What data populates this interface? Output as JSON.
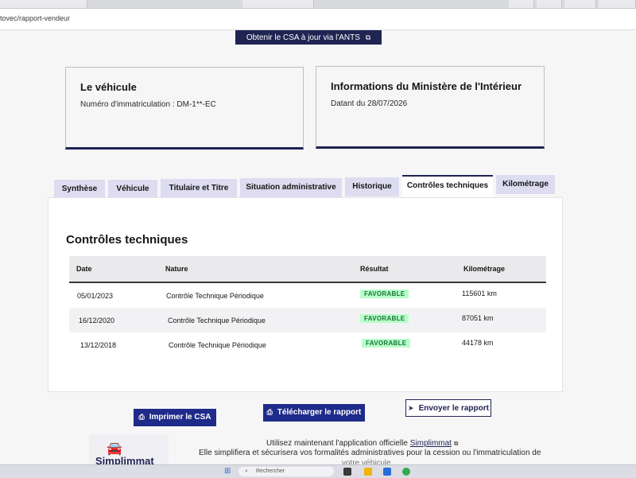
{
  "browser": {
    "tabs": [
      "",
      "",
      "",
      "",
      "",
      ""
    ],
    "url": "tovec/rapport-vendeur"
  },
  "header": {
    "ants_button_label": "Obtenir le CSA à jour via l'ANTS"
  },
  "vehicle_card": {
    "title": "Le véhicule",
    "plate_text": "Numéro d'immatriculation : DM-1**-EC"
  },
  "ministry_card": {
    "title": "Informations du Ministère de l'Intérieur",
    "date_text": "Datant du 28/07/2026"
  },
  "tabs": [
    {
      "label": "Synthèse",
      "active": false
    },
    {
      "label": "Véhicule",
      "active": false
    },
    {
      "label": "Titulaire et Titre",
      "active": false
    },
    {
      "label": "Situation administrative",
      "active": false
    },
    {
      "label": "Historique",
      "active": false
    },
    {
      "label": "Contrôles techniques",
      "active": true
    },
    {
      "label": "Kilométrage",
      "active": false
    }
  ],
  "controls": {
    "title": "Contrôles techniques",
    "columns": {
      "date": "Date",
      "nature": "Nature",
      "result": "Résultat",
      "mileage": "Kilométrage"
    },
    "rows": [
      {
        "date": "05/01/2023",
        "nature": "Contrôle Technique Périodique",
        "result": "FAVORABLE",
        "mileage": "115601 km"
      },
      {
        "date": "16/12/2020",
        "nature": "Contrôle Technique Périodique",
        "result": "FAVORABLE",
        "mileage": "87051 km"
      },
      {
        "date": "13/12/2018",
        "nature": "Contrôle Technique Périodique",
        "result": "FAVORABLE",
        "mileage": "44178 km"
      }
    ]
  },
  "actions": {
    "print_label": "Imprimer le CSA",
    "download_label": "Télécharger le rapport",
    "send_label": "Envoyer le rapport"
  },
  "promo": {
    "logo_name": "Simplimmat",
    "line1_prefix": "Utilisez maintenant l'application officielle",
    "line1_link": "Simplimmat",
    "line2": "Elle simplifiera et sécurisera vos formalités administratives pour la cession ou l'immatriculation de",
    "line3": "votre véhicule"
  },
  "taskbar": {
    "search_placeholder": "Rechercher"
  },
  "colors": {
    "brand": "#1f2452",
    "badge_bg": "#b8fec9",
    "badge_text": "#18753c",
    "tab_bg": "#dddcf0"
  }
}
